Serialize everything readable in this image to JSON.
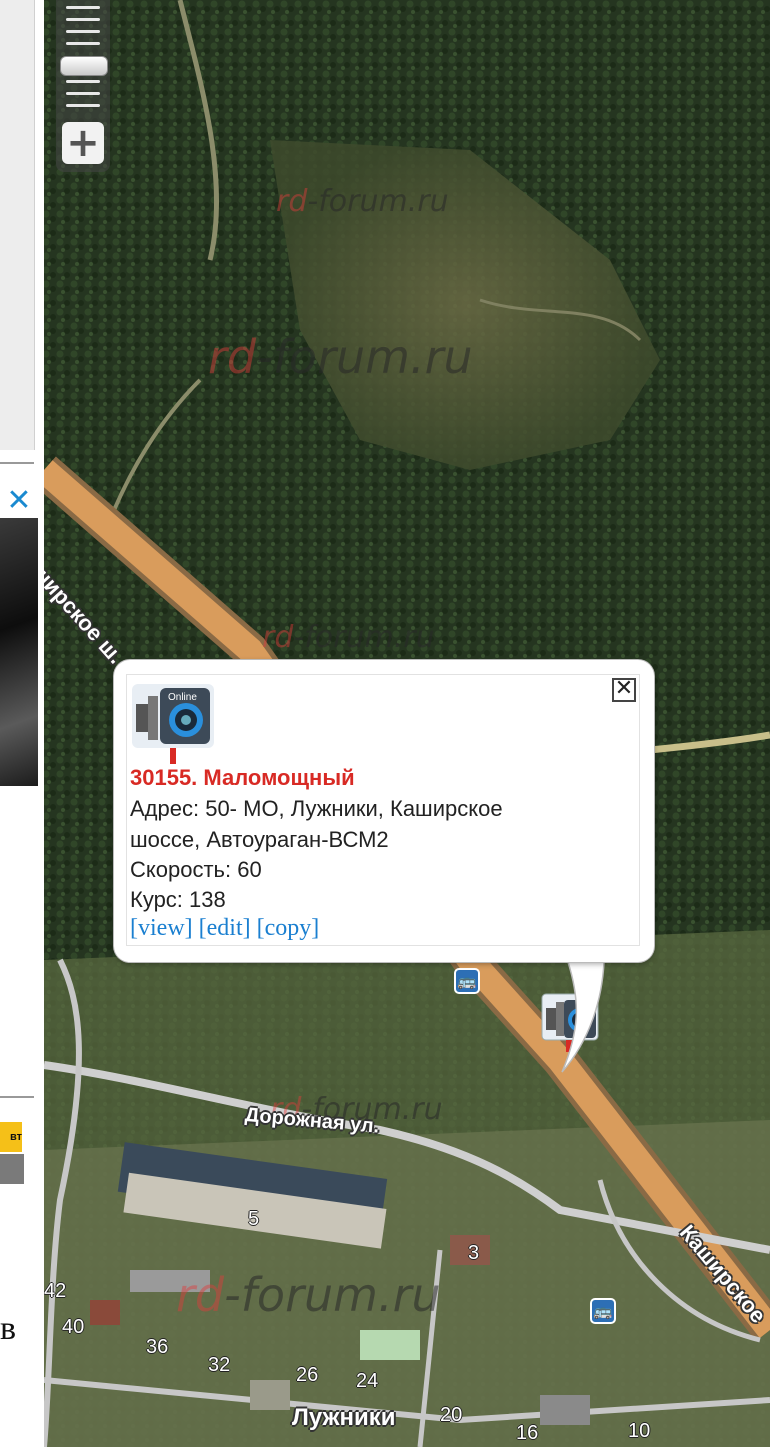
{
  "map": {
    "road_labels": {
      "kashirskoe_upper": "Каширское ш.",
      "kashirskoe_lower": "Каширское",
      "dorozhnaya": "Дорожная ул."
    },
    "locality": "Лужники",
    "house_numbers": [
      "5",
      "3",
      "42",
      "40",
      "36",
      "32",
      "26",
      "24",
      "20",
      "16",
      "10"
    ],
    "watermark": {
      "prefix": "rd",
      "suffix": "forum.ru",
      "dash": "-"
    }
  },
  "zoom_control": {
    "plus_label": "+",
    "icon": "zoom-plus-icon"
  },
  "sidebar": {
    "ad_close_label": "✕",
    "badge_text": "вт",
    "letter": "в"
  },
  "popup": {
    "camera_icon": "speed-camera-online-icon",
    "close_label": "✕",
    "title": "30155. Маломощный",
    "address_line1": "Адрес: 50- МО, Лужники, Каширское",
    "address_line2": "шоссе, Автоураган-ВСМ2",
    "speed": "Скорость: 60",
    "course": "Курс: 138",
    "links": {
      "view": "[view]",
      "edit": "[edit]",
      "copy": "[copy]"
    },
    "camera_badge_text": "Online"
  },
  "bus_stop_icon": "bus-stop-icon",
  "colors": {
    "road": "#d99c5c",
    "popup_title": "#d82a24",
    "link": "#1a7fd0",
    "bus": "#2d6fb5"
  }
}
